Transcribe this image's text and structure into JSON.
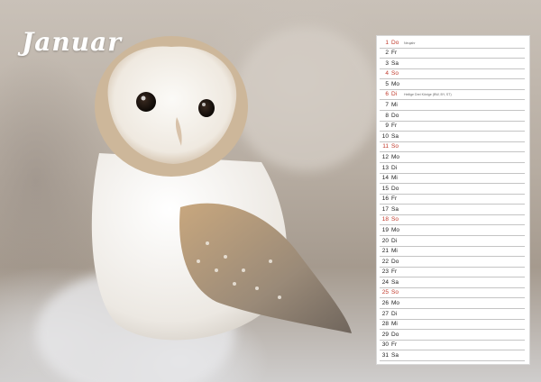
{
  "page": {
    "month": "Januar",
    "holiday_color": "#c0392b"
  },
  "days": [
    {
      "num": "1",
      "wd": "Do",
      "note": "Neujahr",
      "hol": true
    },
    {
      "num": "2",
      "wd": "Fr",
      "note": "",
      "hol": false
    },
    {
      "num": "3",
      "wd": "Sa",
      "note": "",
      "hol": false
    },
    {
      "num": "4",
      "wd": "So",
      "note": "",
      "hol": true
    },
    {
      "num": "5",
      "wd": "Mo",
      "note": "",
      "hol": false
    },
    {
      "num": "6",
      "wd": "Di",
      "note": "Heilige Drei Könige (BW, BY, ST)",
      "hol": true
    },
    {
      "num": "7",
      "wd": "Mi",
      "note": "",
      "hol": false
    },
    {
      "num": "8",
      "wd": "Do",
      "note": "",
      "hol": false
    },
    {
      "num": "9",
      "wd": "Fr",
      "note": "",
      "hol": false
    },
    {
      "num": "10",
      "wd": "Sa",
      "note": "",
      "hol": false
    },
    {
      "num": "11",
      "wd": "So",
      "note": "",
      "hol": true
    },
    {
      "num": "12",
      "wd": "Mo",
      "note": "",
      "hol": false
    },
    {
      "num": "13",
      "wd": "Di",
      "note": "",
      "hol": false
    },
    {
      "num": "14",
      "wd": "Mi",
      "note": "",
      "hol": false
    },
    {
      "num": "15",
      "wd": "Do",
      "note": "",
      "hol": false
    },
    {
      "num": "16",
      "wd": "Fr",
      "note": "",
      "hol": false
    },
    {
      "num": "17",
      "wd": "Sa",
      "note": "",
      "hol": false
    },
    {
      "num": "18",
      "wd": "So",
      "note": "",
      "hol": true
    },
    {
      "num": "19",
      "wd": "Mo",
      "note": "",
      "hol": false
    },
    {
      "num": "20",
      "wd": "Di",
      "note": "",
      "hol": false
    },
    {
      "num": "21",
      "wd": "Mi",
      "note": "",
      "hol": false
    },
    {
      "num": "22",
      "wd": "Do",
      "note": "",
      "hol": false
    },
    {
      "num": "23",
      "wd": "Fr",
      "note": "",
      "hol": false
    },
    {
      "num": "24",
      "wd": "Sa",
      "note": "",
      "hol": false
    },
    {
      "num": "25",
      "wd": "So",
      "note": "",
      "hol": true
    },
    {
      "num": "26",
      "wd": "Mo",
      "note": "",
      "hol": false
    },
    {
      "num": "27",
      "wd": "Di",
      "note": "",
      "hol": false
    },
    {
      "num": "28",
      "wd": "Mi",
      "note": "",
      "hol": false
    },
    {
      "num": "29",
      "wd": "Do",
      "note": "",
      "hol": false
    },
    {
      "num": "30",
      "wd": "Fr",
      "note": "",
      "hol": false
    },
    {
      "num": "31",
      "wd": "Sa",
      "note": "",
      "hol": false
    }
  ]
}
